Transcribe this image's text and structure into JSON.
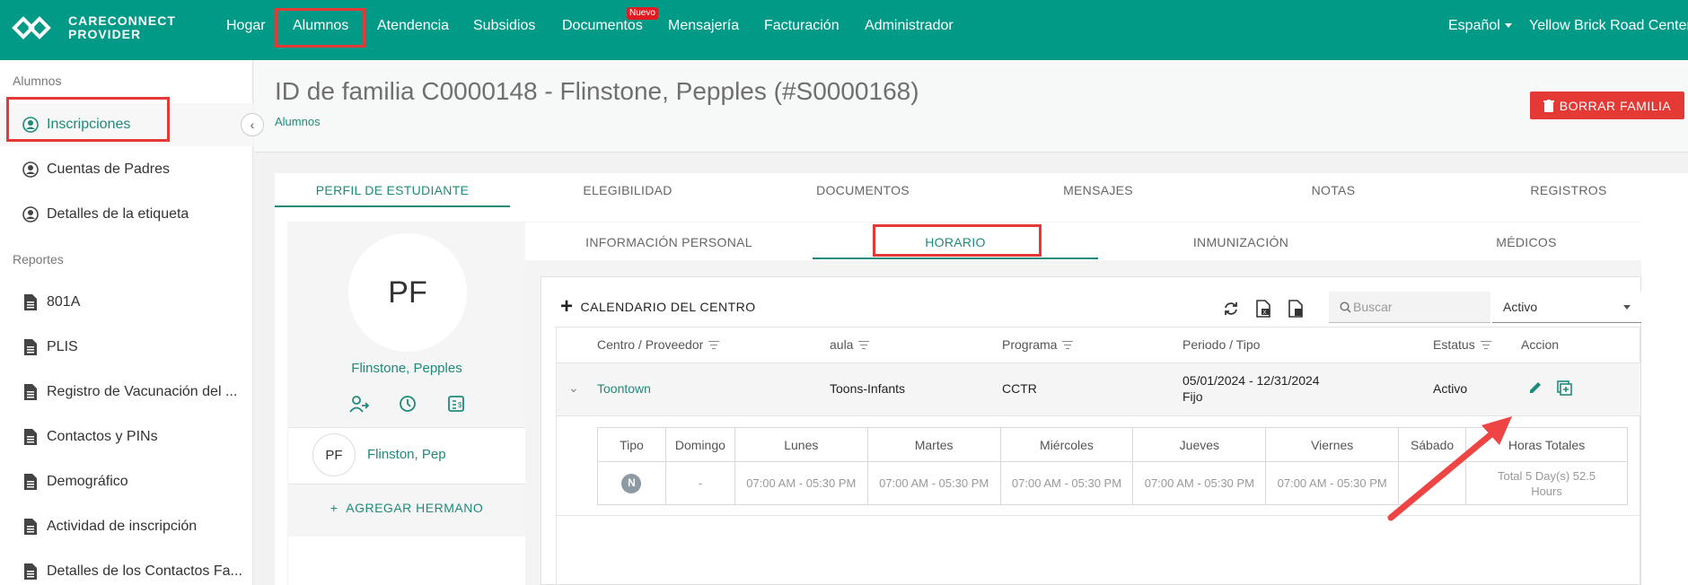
{
  "brand": {
    "line1": "CARECONNECT",
    "line2": "PROVIDER"
  },
  "nav": {
    "items": [
      {
        "label": "Hogar"
      },
      {
        "label": "Alumnos"
      },
      {
        "label": "Atendencia"
      },
      {
        "label": "Subsidios"
      },
      {
        "label": "Documentos",
        "badge": "Nuevo"
      },
      {
        "label": "Mensajería"
      },
      {
        "label": "Facturación"
      },
      {
        "label": "Administrador"
      }
    ],
    "language": "Español",
    "center": "Yellow Brick Road Center"
  },
  "sidebar": {
    "section1": "Alumnos",
    "students": [
      {
        "label": "Inscripciones",
        "icon": "user-circle-icon"
      },
      {
        "label": "Cuentas de Padres",
        "icon": "user-circle-icon"
      },
      {
        "label": "Detalles de la etiqueta",
        "icon": "user-circle-icon"
      }
    ],
    "section2": "Reportes",
    "reports": [
      {
        "label": "801A",
        "icon": "document-icon"
      },
      {
        "label": "PLIS",
        "icon": "document-icon"
      },
      {
        "label": "Registro de Vacunación del ...",
        "icon": "document-icon"
      },
      {
        "label": "Contactos y PINs",
        "icon": "document-icon"
      },
      {
        "label": "Demográfico",
        "icon": "document-icon"
      },
      {
        "label": "Actividad de inscripción",
        "icon": "document-icon"
      },
      {
        "label": "Detalles de los Contactos Fa...",
        "icon": "document-icon"
      }
    ]
  },
  "header": {
    "title": "ID de familia C0000148 - Flinstone, Pepples (#S0000168)",
    "breadcrumb": "Alumnos",
    "delete_button": "BORRAR FAMILIA"
  },
  "tabs": [
    "PERFIL DE ESTUDIANTE",
    "ELEGIBILIDAD",
    "DOCUMENTOS",
    "MENSAJES",
    "NOTAS",
    "REGISTROS"
  ],
  "profile": {
    "initials": "PF",
    "name": "Flinstone, Pepples",
    "sibling": {
      "initials": "PF",
      "name": "Flinston, Pep"
    },
    "add_sibling": "AGREGAR HERMANO"
  },
  "subtabs": [
    "INFORMACIÓN PERSONAL",
    "HORARIO",
    "INMUNIZACIÓN",
    "MÉDICOS"
  ],
  "schedule": {
    "calendar_button": "CALENDARIO DEL CENTRO",
    "search_placeholder": "Buscar",
    "status_filter": "Activo",
    "columns": [
      "Centro / Proveedor",
      "aula",
      "Programa",
      "Periodo / Tipo",
      "Estatus",
      "Accion"
    ],
    "row": {
      "center": "Toontown",
      "classroom": "Toons-Infants",
      "program": "CCTR",
      "period": "05/01/2024 - 12/31/2024",
      "type": "Fijo",
      "status": "Activo"
    },
    "days_header": [
      "Tipo",
      "Domingo",
      "Lunes",
      "Martes",
      "Miércoles",
      "Jueves",
      "Viernes",
      "Sábado",
      "Horas Totales"
    ],
    "days_row": {
      "type_badge": "N",
      "domingo": "-",
      "lunes": "07:00 AM - 05:30 PM",
      "martes": "07:00 AM - 05:30 PM",
      "miercoles": "07:00 AM - 05:30 PM",
      "jueves": "07:00 AM - 05:30 PM",
      "viernes": "07:00 AM - 05:30 PM",
      "sabado": "",
      "total": "Total 5 Day(s) 52.5 Hours"
    }
  },
  "colors": {
    "primary": "#009a86",
    "accent_text": "#1e8a7b",
    "danger": "#e53935"
  }
}
